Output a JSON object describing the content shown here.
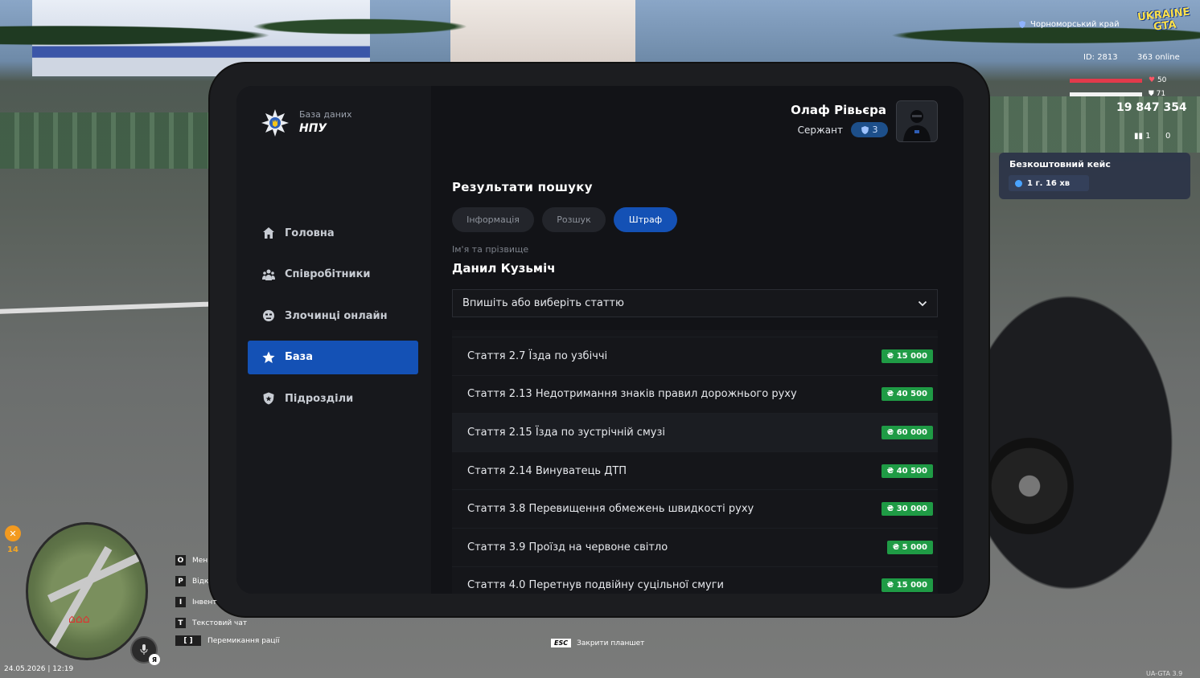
{
  "colors": {
    "accent": "#1451b5",
    "price_green": "#1f9b45",
    "panel": "#131418"
  },
  "tablet": {
    "logo_sub": "База даних",
    "logo_title": "НПУ",
    "nav": [
      {
        "label": "Головна",
        "icon": "home-icon"
      },
      {
        "label": "Співробітники",
        "icon": "users-icon"
      },
      {
        "label": "Злочинці онлайн",
        "icon": "criminal-icon"
      },
      {
        "label": "База",
        "icon": "star-icon",
        "active": true
      },
      {
        "label": "Підрозділи",
        "icon": "shield-icon"
      }
    ],
    "user": {
      "name": "Олаф Рівьєра",
      "rank": "Сержант",
      "rank_level": "3"
    },
    "title": "Результати пошуку",
    "tabs": [
      {
        "label": "Інформація"
      },
      {
        "label": "Розшук"
      },
      {
        "label": "Штраф",
        "active": true
      }
    ],
    "field_label": "Ім'я та прізвище",
    "field_value": "Данил Кузьміч",
    "select_placeholder": "Впишіть або виберіть статтю",
    "articles": [
      {
        "article": "Стаття 2.7",
        "text": "Їзда по узбіччі",
        "price": "₴ 15 000"
      },
      {
        "article": "Стаття 2.13",
        "text": "Недотримання знаків правил дорожнього руху",
        "price": "₴ 40 500"
      },
      {
        "article": "Стаття 2.15",
        "text": "Їзда по зустрічній смузі",
        "price": "₴ 60 000"
      },
      {
        "article": "Стаття 2.14",
        "text": "Винуватець ДТП",
        "price": "₴ 40 500"
      },
      {
        "article": "Стаття 3.8",
        "text": "Перевищення обмежень швидкості руху",
        "price": "₴ 30 000"
      },
      {
        "article": "Стаття 3.9",
        "text": "Проїзд на червоне світло",
        "price": "₴ 5 000"
      },
      {
        "article": "Стаття 4.0",
        "text": "Перетнув подвійну суцільної смуги",
        "price": "₴ 15 000"
      }
    ]
  },
  "hud": {
    "region": "Чорноморський край",
    "logo_text": "UKRAINE GTA",
    "id": "ID: 2813",
    "online": "363 online",
    "health": "50",
    "armor": "71",
    "money": "19 847 354",
    "stat_left": "1",
    "stat_right": "0",
    "case_title": "Безкоштовний кейс",
    "case_timer": "1 г. 16 хв",
    "hunger": "14",
    "hints": [
      {
        "key": "O",
        "label": "Мен"
      },
      {
        "key": "P",
        "label": "Відк"
      },
      {
        "key": "I",
        "label": "Інвент"
      },
      {
        "key": "T",
        "label": "Текстовий чат"
      },
      {
        "key": "[ ]",
        "label": "Перемикання рації"
      }
    ],
    "esc_key": "ESC",
    "esc_label": "Закрити планшет",
    "datetime": "24.05.2026 | 12:19",
    "mic_key": "Я",
    "version": "UA-GTA 3.9"
  }
}
